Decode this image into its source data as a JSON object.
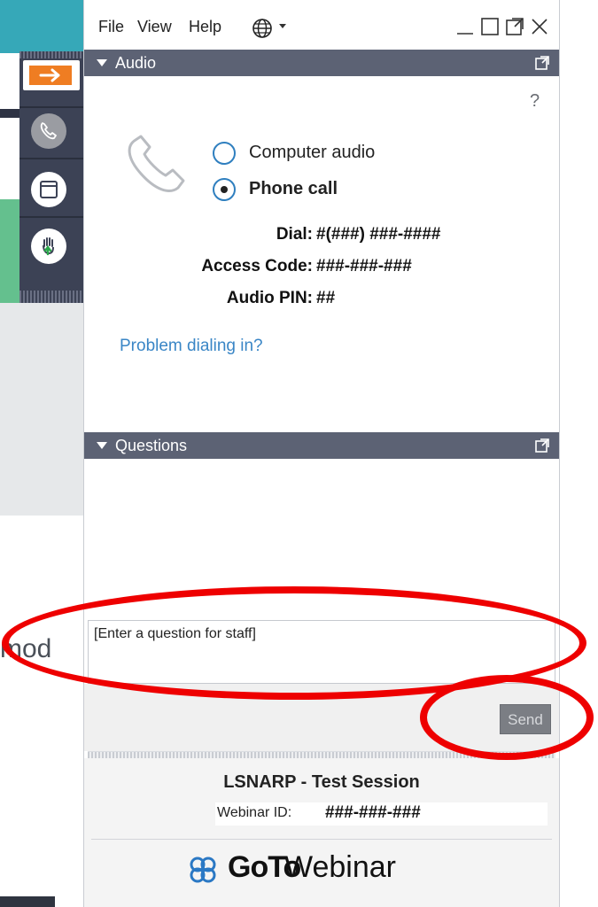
{
  "menubar": {
    "items": [
      "File",
      "View",
      "Help"
    ]
  },
  "audio": {
    "header": "Audio",
    "help": "?",
    "options": [
      "Computer audio",
      "Phone call"
    ],
    "selected": 1,
    "dial_label": "Dial:",
    "dial_value": "#(###) ###-####",
    "access_label": "Access Code:",
    "access_value": "###-###-###",
    "pin_label": "Audio PIN:",
    "pin_value": "##",
    "problem_link": "Problem dialing in?"
  },
  "questions": {
    "header": "Questions",
    "input_placeholder": "[Enter a question for staff]",
    "send_label": "Send"
  },
  "footer": {
    "session_title": "LSNARP - Test Session",
    "webinar_label": "Webinar ID:",
    "webinar_value": "###-###-###",
    "brand_bold": "GoTo",
    "brand_regular": "Webinar"
  },
  "background": {
    "mode_text": "mod"
  },
  "colors": {
    "header_bg": "#5c6274",
    "toolbar_bg": "#3c4255",
    "link": "#3a86c6",
    "annotation": "#ee0000",
    "accent": "#ef7d22"
  }
}
